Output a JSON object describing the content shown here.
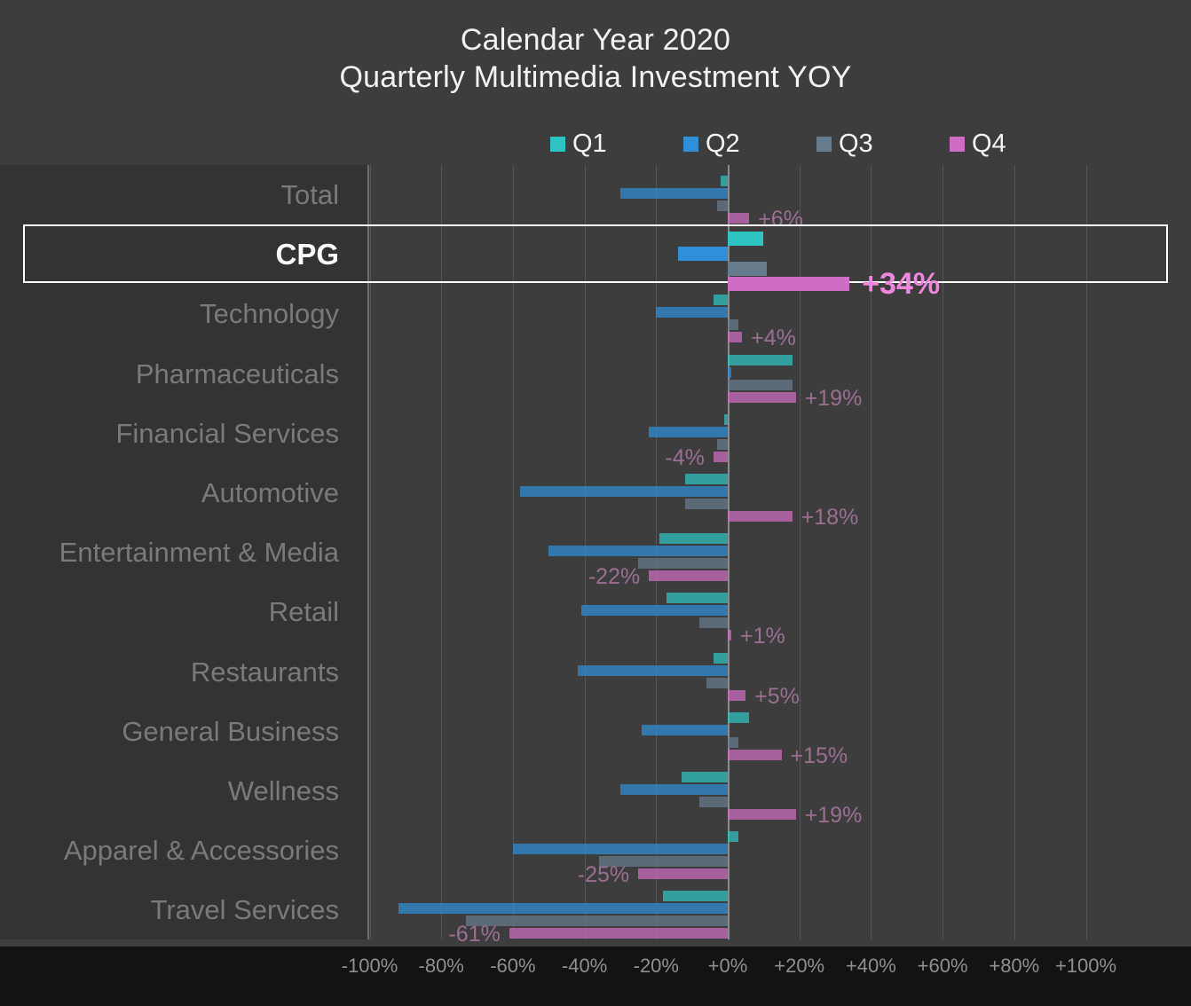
{
  "title": {
    "line1": "Calendar Year 2020",
    "line2": "Quarterly Multimedia Investment YOY"
  },
  "legend": {
    "position": "top-center",
    "items": [
      {
        "label": "Q1",
        "color": "#2ec4c4"
      },
      {
        "label": "Q2",
        "color": "#2f8fd8"
      },
      {
        "label": "Q3",
        "color": "#667b8c"
      },
      {
        "label": "Q4",
        "color": "#cf6dc4"
      }
    ]
  },
  "axis": {
    "ticks": [
      "-100%",
      "-80%",
      "-60%",
      "-40%",
      "-20%",
      "+0%",
      "+20%",
      "+40%",
      "+60%",
      "+80%",
      "+100%"
    ],
    "min": -100,
    "max": 100,
    "step": 20
  },
  "highlight": {
    "category": "CPG",
    "value_label": "+34%"
  },
  "chart_data": {
    "type": "bar",
    "orientation": "horizontal",
    "title": "Calendar Year 2020 Quarterly Multimedia Investment YOY",
    "xlabel": "",
    "ylabel": "",
    "xlim": [
      -100,
      100
    ],
    "grid": true,
    "legend_position": "top",
    "categories": [
      "Total",
      "CPG",
      "Technology",
      "Pharmaceuticals",
      "Financial Services",
      "Automotive",
      "Entertainment & Media",
      "Retail",
      "Restaurants",
      "General Business",
      "Wellness",
      "Apparel & Accessories",
      "Travel Services"
    ],
    "series": [
      {
        "name": "Q1",
        "color": "#2ec4c4",
        "values": [
          -2,
          10,
          -4,
          18,
          -1,
          -12,
          -19,
          -17,
          -4,
          6,
          -13,
          3,
          -18
        ]
      },
      {
        "name": "Q2",
        "color": "#2f8fd8",
        "values": [
          -30,
          -14,
          -20,
          1,
          -22,
          -58,
          -50,
          -41,
          -42,
          -24,
          -30,
          -60,
          -92
        ]
      },
      {
        "name": "Q3",
        "color": "#667b8c",
        "values": [
          -3,
          11,
          3,
          18,
          -3,
          -12,
          -25,
          -8,
          -6,
          3,
          -8,
          -36,
          -73
        ]
      },
      {
        "name": "Q4",
        "color": "#cf6dc4",
        "values": [
          6,
          34,
          4,
          19,
          -4,
          18,
          -22,
          1,
          5,
          15,
          19,
          -25,
          -61
        ]
      }
    ],
    "q4_labels": [
      "+6%",
      "+34%",
      "+4%",
      "+19%",
      "-4%",
      "+18%",
      "-22%",
      "+1%",
      "+5%",
      "+15%",
      "+19%",
      "-25%",
      "-61%"
    ]
  },
  "colors": {
    "background": "#1a1a1a",
    "panel": "#3d3d3d",
    "axis_strip": "#131313",
    "gridline": "#555555",
    "zero_line": "#8c8c8c",
    "label_text": "#7a7a7a",
    "highlight_text": "#ffffff",
    "highlight_value": "#ef87de",
    "value_text": "#9b6f92"
  }
}
